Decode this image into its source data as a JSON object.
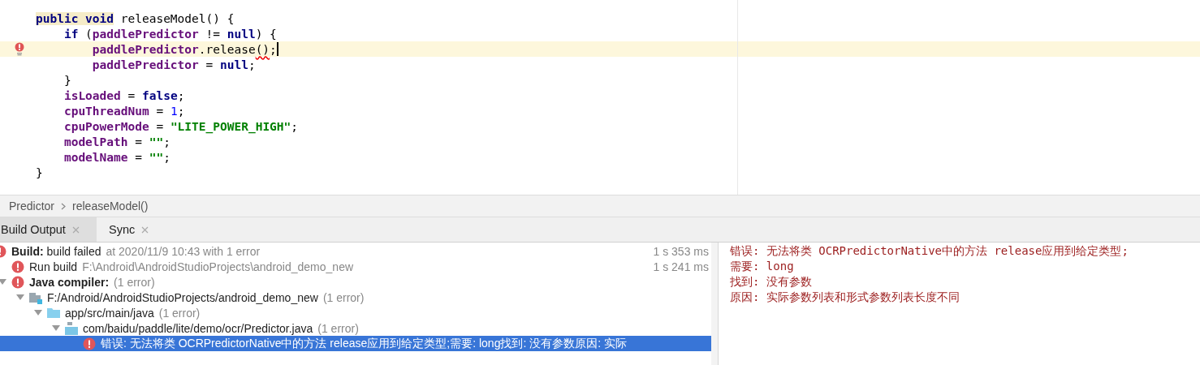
{
  "editor": {
    "lines": [
      {
        "tokens": [
          {
            "t": "public void",
            "kind": "kw",
            "hl": true
          },
          {
            "t": " releaseModel() {",
            "kind": "plain"
          }
        ]
      },
      {
        "tokens": [
          {
            "t": "    if",
            "kind": "kw"
          },
          {
            "t": " (",
            "kind": "plain"
          },
          {
            "t": "paddlePredictor",
            "kind": "field"
          },
          {
            "t": " != ",
            "kind": "plain"
          },
          {
            "t": "null",
            "kind": "kw"
          },
          {
            "t": ") {",
            "kind": "plain"
          }
        ]
      },
      {
        "current": true,
        "error": true,
        "caret": true,
        "tokens": [
          {
            "t": "        paddlePredictor",
            "kind": "field"
          },
          {
            "t": ".release",
            "kind": "plain"
          },
          {
            "t": "()",
            "kind": "plain",
            "squiggle": true
          },
          {
            "t": ";",
            "kind": "plain"
          }
        ]
      },
      {
        "tokens": [
          {
            "t": "        paddlePredictor",
            "kind": "field"
          },
          {
            "t": " = ",
            "kind": "plain"
          },
          {
            "t": "null",
            "kind": "kw"
          },
          {
            "t": ";",
            "kind": "plain"
          }
        ]
      },
      {
        "tokens": [
          {
            "t": "    }",
            "kind": "plain"
          }
        ]
      },
      {
        "tokens": [
          {
            "t": "    isLoaded",
            "kind": "field"
          },
          {
            "t": " = ",
            "kind": "plain"
          },
          {
            "t": "false",
            "kind": "kw"
          },
          {
            "t": ";",
            "kind": "plain"
          }
        ]
      },
      {
        "tokens": [
          {
            "t": "    cpuThreadNum",
            "kind": "field"
          },
          {
            "t": " = ",
            "kind": "plain"
          },
          {
            "t": "1",
            "kind": "num"
          },
          {
            "t": ";",
            "kind": "plain"
          }
        ]
      },
      {
        "tokens": [
          {
            "t": "    cpuPowerMode",
            "kind": "field"
          },
          {
            "t": " = ",
            "kind": "plain"
          },
          {
            "t": "\"LITE_POWER_HIGH\"",
            "kind": "str"
          },
          {
            "t": ";",
            "kind": "plain"
          }
        ]
      },
      {
        "tokens": [
          {
            "t": "    modelPath",
            "kind": "field"
          },
          {
            "t": " = ",
            "kind": "plain"
          },
          {
            "t": "\"\"",
            "kind": "str"
          },
          {
            "t": ";",
            "kind": "plain"
          }
        ]
      },
      {
        "tokens": [
          {
            "t": "    modelName",
            "kind": "field"
          },
          {
            "t": " = ",
            "kind": "plain"
          },
          {
            "t": "\"\"",
            "kind": "str"
          },
          {
            "t": ";",
            "kind": "plain"
          }
        ]
      },
      {
        "tokens": [
          {
            "t": "}",
            "kind": "plain"
          }
        ]
      }
    ]
  },
  "breadcrumb": [
    "Predictor",
    "releaseModel()"
  ],
  "tabs": [
    {
      "label": "Build Output",
      "selected": true
    },
    {
      "label": "Sync",
      "selected": false
    }
  ],
  "build_tree": [
    {
      "label": "**Build:** build failed",
      "note": "at 2020/11/9 10:43  with 1 error",
      "time": "1 s 353 ms",
      "kind": "error",
      "selected": false,
      "children": [
        {
          "label": "Run build",
          "note": "F:\\Android\\AndroidStudioProjects\\android_demo_new",
          "time": "1 s 241 ms",
          "kind": "error",
          "selected": false
        },
        {
          "label": "**Java compiler:**",
          "note": "(1 error)",
          "kind": "error",
          "expanded": true,
          "selected": false,
          "children": [
            {
              "label": "F:/Android/AndroidStudioProjects/android_demo_new",
              "note": "(1 error)",
              "kind": "module",
              "expanded": true,
              "selected": false,
              "children": [
                {
                  "label": "app/src/main/java",
                  "note": "(1 error)",
                  "kind": "folder",
                  "expanded": true,
                  "selected": false,
                  "children": [
                    {
                      "label": "com/baidu/paddle/lite/demo/ocr/Predictor.java",
                      "note": "(1 error)",
                      "kind": "javafile",
                      "expanded": true,
                      "selected": false,
                      "children": [
                        {
                          "label": "错误: 无法将类 OCRPredictorNative中的方法 release应用到给定类型;需要: long找到: 没有参数原因: 实际",
                          "kind": "error",
                          "selected": true
                        }
                      ]
                    }
                  ]
                }
              ]
            }
          ]
        }
      ]
    }
  ],
  "console": [
    "错误: 无法将类 OCRPredictorNative中的方法 release应用到给定类型;",
    "需要: long",
    "找到: 没有参数",
    "原因: 实际参数列表和形式参数列表长度不同"
  ]
}
